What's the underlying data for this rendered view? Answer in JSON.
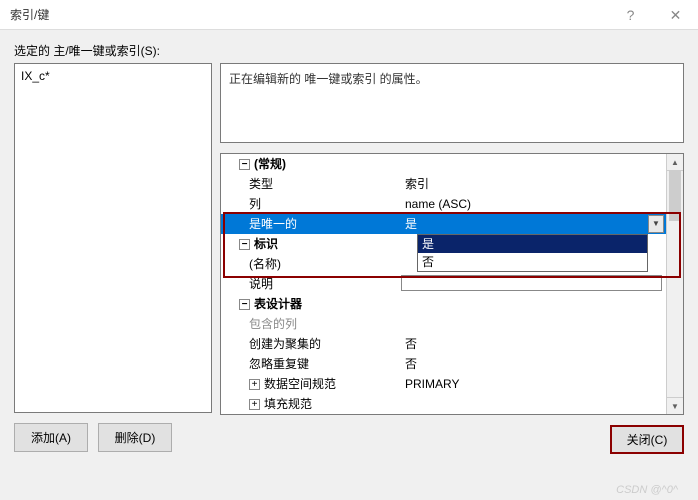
{
  "titlebar": {
    "title": "索引/键",
    "help": "?",
    "close": "✕"
  },
  "label_top": "选定的 主/唯一键或索引(S):",
  "listbox": {
    "items": [
      "IX_c*"
    ]
  },
  "buttons": {
    "add": "添加(A)",
    "delete": "删除(D)",
    "close": "关闭(C)"
  },
  "desc": "正在编辑新的 唯一键或索引 的属性。",
  "props": {
    "cat_general": "(常规)",
    "type_k": "类型",
    "type_v": "索引",
    "col_k": "列",
    "col_v": "name (ASC)",
    "unique_k": "是唯一的",
    "unique_v": "是",
    "cat_ident": "标识",
    "name_k": "(名称)",
    "name_v": "",
    "desc_k": "说明",
    "desc_v": "",
    "cat_designer": "表设计器",
    "included_k": "包含的列",
    "included_v": "",
    "clustered_k": "创建为聚集的",
    "clustered_v": "否",
    "ignoredup_k": "忽略重复键",
    "ignoredup_v": "否",
    "dataspace_k": "数据空间规范",
    "dataspace_v": "PRIMARY",
    "fill_k": "填充规范",
    "fill_v": ""
  },
  "dropdown": {
    "opt_yes": "是",
    "opt_no": "否"
  },
  "exp": {
    "minus": "−",
    "plus": "+"
  },
  "scroll": {
    "up": "▲",
    "down": "▼"
  },
  "watermark": "CSDN @^0^"
}
